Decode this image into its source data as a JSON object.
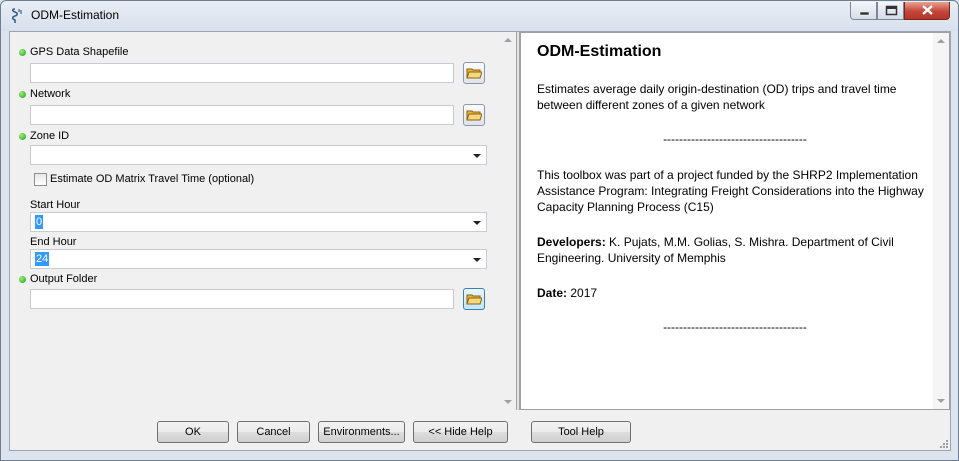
{
  "window": {
    "title": "ODM-Estimation"
  },
  "params": {
    "gps": {
      "label": "GPS Data Shapefile",
      "value": ""
    },
    "network": {
      "label": "Network",
      "value": ""
    },
    "zone": {
      "label": "Zone ID",
      "value": ""
    },
    "estimate": {
      "label": "Estimate OD Matrix Travel Time (optional)",
      "checked": false
    },
    "start": {
      "label": "Start Hour",
      "value": "0"
    },
    "end": {
      "label": "End Hour",
      "value": "24"
    },
    "output": {
      "label": "Output Folder",
      "value": ""
    }
  },
  "help": {
    "title": "ODM-Estimation",
    "desc": "Estimates average daily origin-destination (OD) trips and travel time between different zones of a given network",
    "separator": "------------------------------------",
    "funding": "This toolbox was part of a project funded by the SHRP2 Implementation Assistance Program: Integrating Freight Considerations into the Highway Capacity Planning Process (C15)",
    "dev_label": "Developers:",
    "dev_text": " K. Pujats, M.M. Golias, S. Mishra. Department of Civil Engineering. University of Memphis",
    "date_label": "Date:",
    "date_text": " 2017"
  },
  "buttons": {
    "ok": "OK",
    "cancel": "Cancel",
    "env": "Environments...",
    "hide": "<< Hide Help",
    "toolhelp": "Tool Help"
  },
  "colors": {
    "required_dot": "#1a9b14",
    "selection": "#3399ff",
    "close_button": "#c4463a"
  },
  "icons": [
    "python-script-icon",
    "minimize-icon",
    "maximize-icon",
    "close-icon",
    "folder-open-icon",
    "chevron-down-icon",
    "resize-grip-icon"
  ]
}
